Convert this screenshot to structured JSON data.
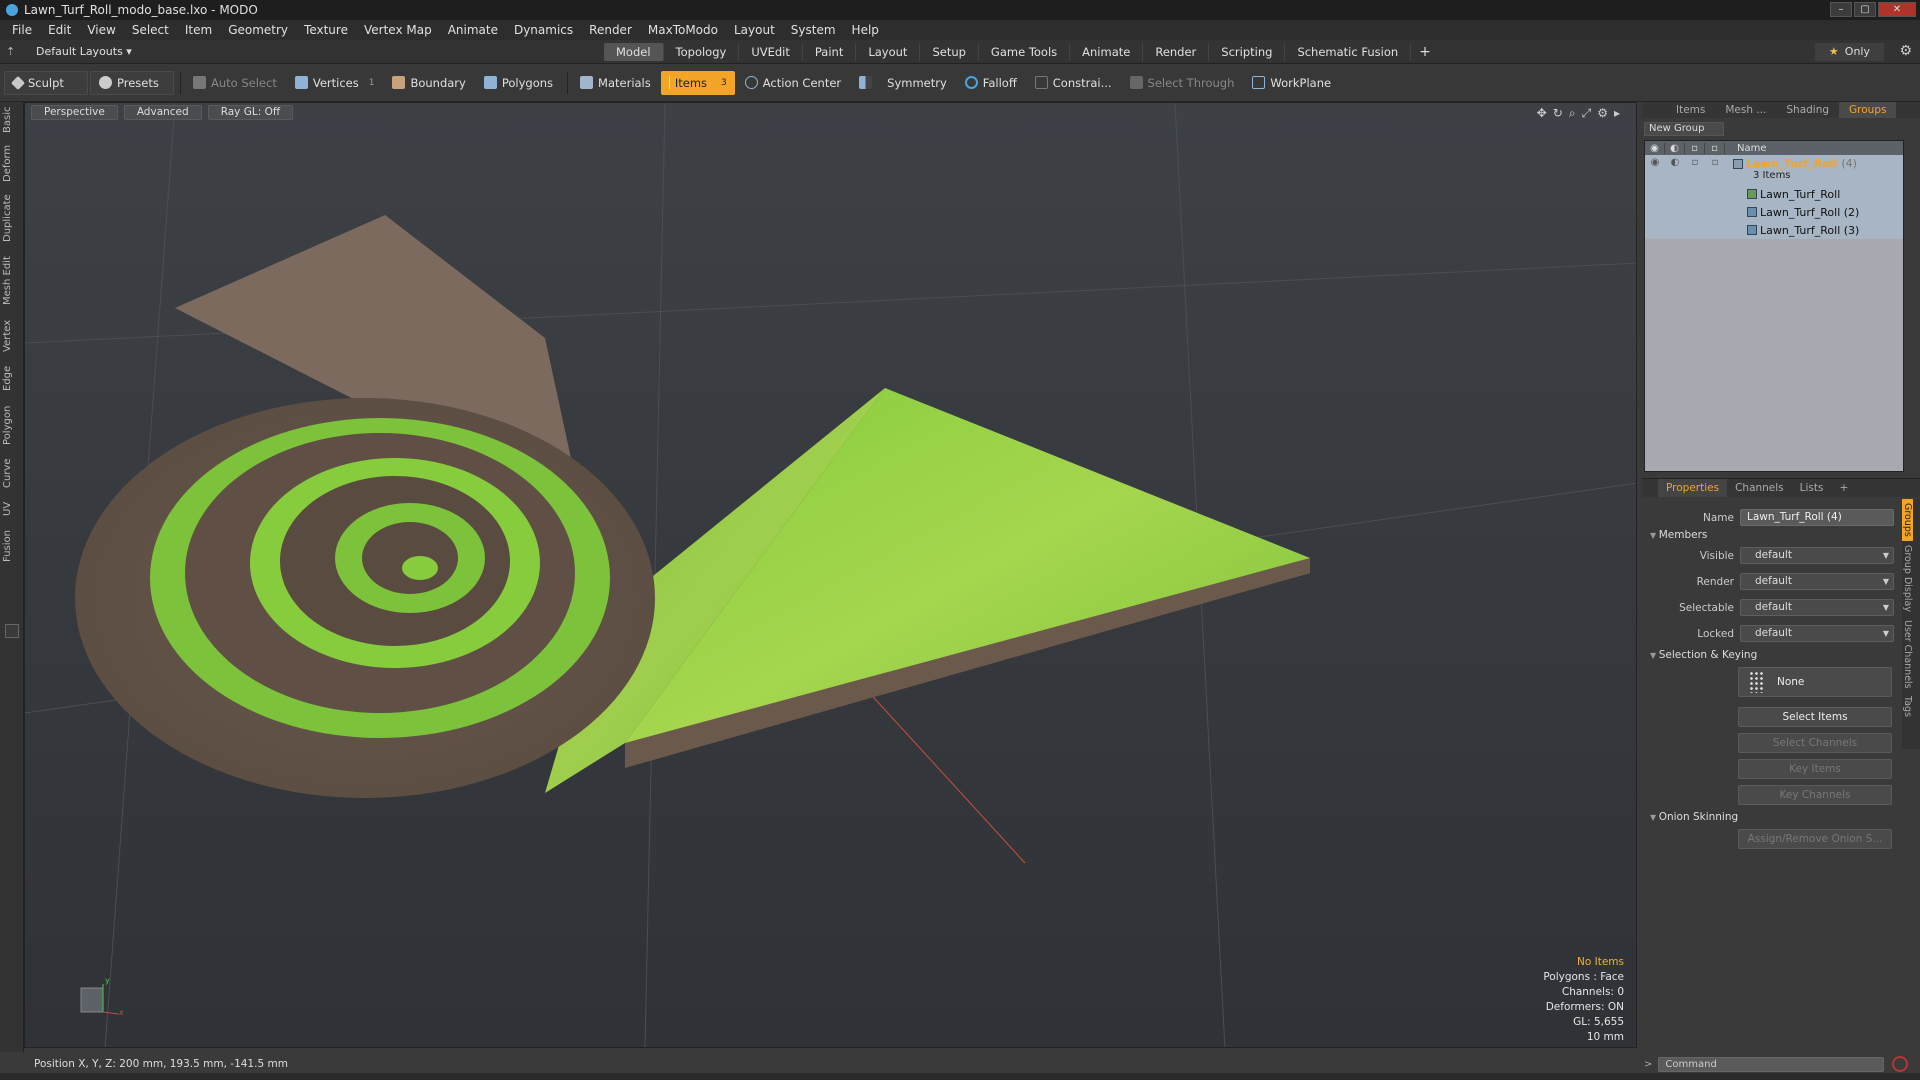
{
  "window": {
    "title": "Lawn_Turf_Roll_modo_base.lxo - MODO",
    "controls": [
      "–",
      "▢",
      "✕"
    ]
  },
  "menu": [
    "File",
    "Edit",
    "View",
    "Select",
    "Item",
    "Geometry",
    "Texture",
    "Vertex Map",
    "Animate",
    "Dynamics",
    "Render",
    "MaxToModo",
    "Layout",
    "System",
    "Help"
  ],
  "layoutbar": {
    "layout_label": "Default Layouts ▾",
    "tabs": [
      "Model",
      "Topology",
      "UVEdit",
      "Paint",
      "Layout",
      "Setup",
      "Game Tools",
      "Animate",
      "Render",
      "Scripting",
      "Schematic Fusion"
    ],
    "active_tab": "Model",
    "plus": "+",
    "only_star": "★",
    "only_label": "Only",
    "gear": "⚙"
  },
  "toolbar": {
    "sculpt": "Sculpt",
    "presets": "Presets",
    "auto_select": "Auto Select",
    "vertices": "Vertices",
    "vertices_count": "1",
    "boundary": "Boundary",
    "polygons": "Polygons",
    "materials": "Materials",
    "items": "Items",
    "items_count": "3",
    "action_center": "Action Center",
    "symmetry": "Symmetry",
    "falloff": "Falloff",
    "constraints": "Constrai...",
    "select_through": "Select Through",
    "workplane": "WorkPlane"
  },
  "left_tabs": [
    "Basic",
    "Deform",
    "Duplicate",
    "Mesh Edit",
    "Vertex",
    "Edge",
    "Polygon",
    "Curve",
    "UV",
    "Fusion"
  ],
  "viewport": {
    "view_mode": "Perspective",
    "shading": "Advanced",
    "raygl": "Ray GL: Off",
    "info": {
      "selection": "No Items",
      "polygons": "Polygons : Face",
      "channels": "Channels: 0",
      "deformers": "Deformers: ON",
      "gl": "GL: 5,655",
      "grid": "10 mm"
    },
    "axis_labels": {
      "x": "x",
      "y": "y"
    }
  },
  "status": {
    "position": "Position X, Y, Z:  200 mm, 193.5 mm, -141.5 mm"
  },
  "groups_panel": {
    "tabs": [
      "Items",
      "Mesh ...",
      "Shading",
      "Groups"
    ],
    "active_tab": "Groups",
    "new_group": "New Group",
    "column_name": "Name",
    "group": {
      "name": "Lawn_Turf_Roll",
      "count": "(4)",
      "subtitle": "3 Items"
    },
    "members": [
      "Lawn_Turf_Roll",
      "Lawn_Turf_Roll (2)",
      "Lawn_Turf_Roll (3)"
    ]
  },
  "properties": {
    "tabs": [
      "Properties",
      "Channels",
      "Lists",
      "+"
    ],
    "active_tab": "Properties",
    "name_label": "Name",
    "name_value": "Lawn_Turf_Roll (4)",
    "members_section": "Members",
    "visible_label": "Visible",
    "visible_value": "default",
    "render_label": "Render",
    "render_value": "default",
    "selectable_label": "Selectable",
    "selectable_value": "default",
    "locked_label": "Locked",
    "locked_value": "default",
    "selection_section": "Selection & Keying",
    "none_label": "None",
    "select_items": "Select Items",
    "select_channels": "Select Channels",
    "key_items": "Key Items",
    "key_channels": "Key Channels",
    "onion_section": "Onion Skinning",
    "assign_onion": "Assign/Remove Onion S...",
    "side_tabs": [
      "Groups",
      "Group Display",
      "User Channels",
      "Tags"
    ]
  },
  "command": {
    "arrow": ">",
    "placeholder": "Command"
  },
  "colors": {
    "accent": "#f3a528",
    "grass": "#7cc43a",
    "soil": "#6b5a4c"
  }
}
